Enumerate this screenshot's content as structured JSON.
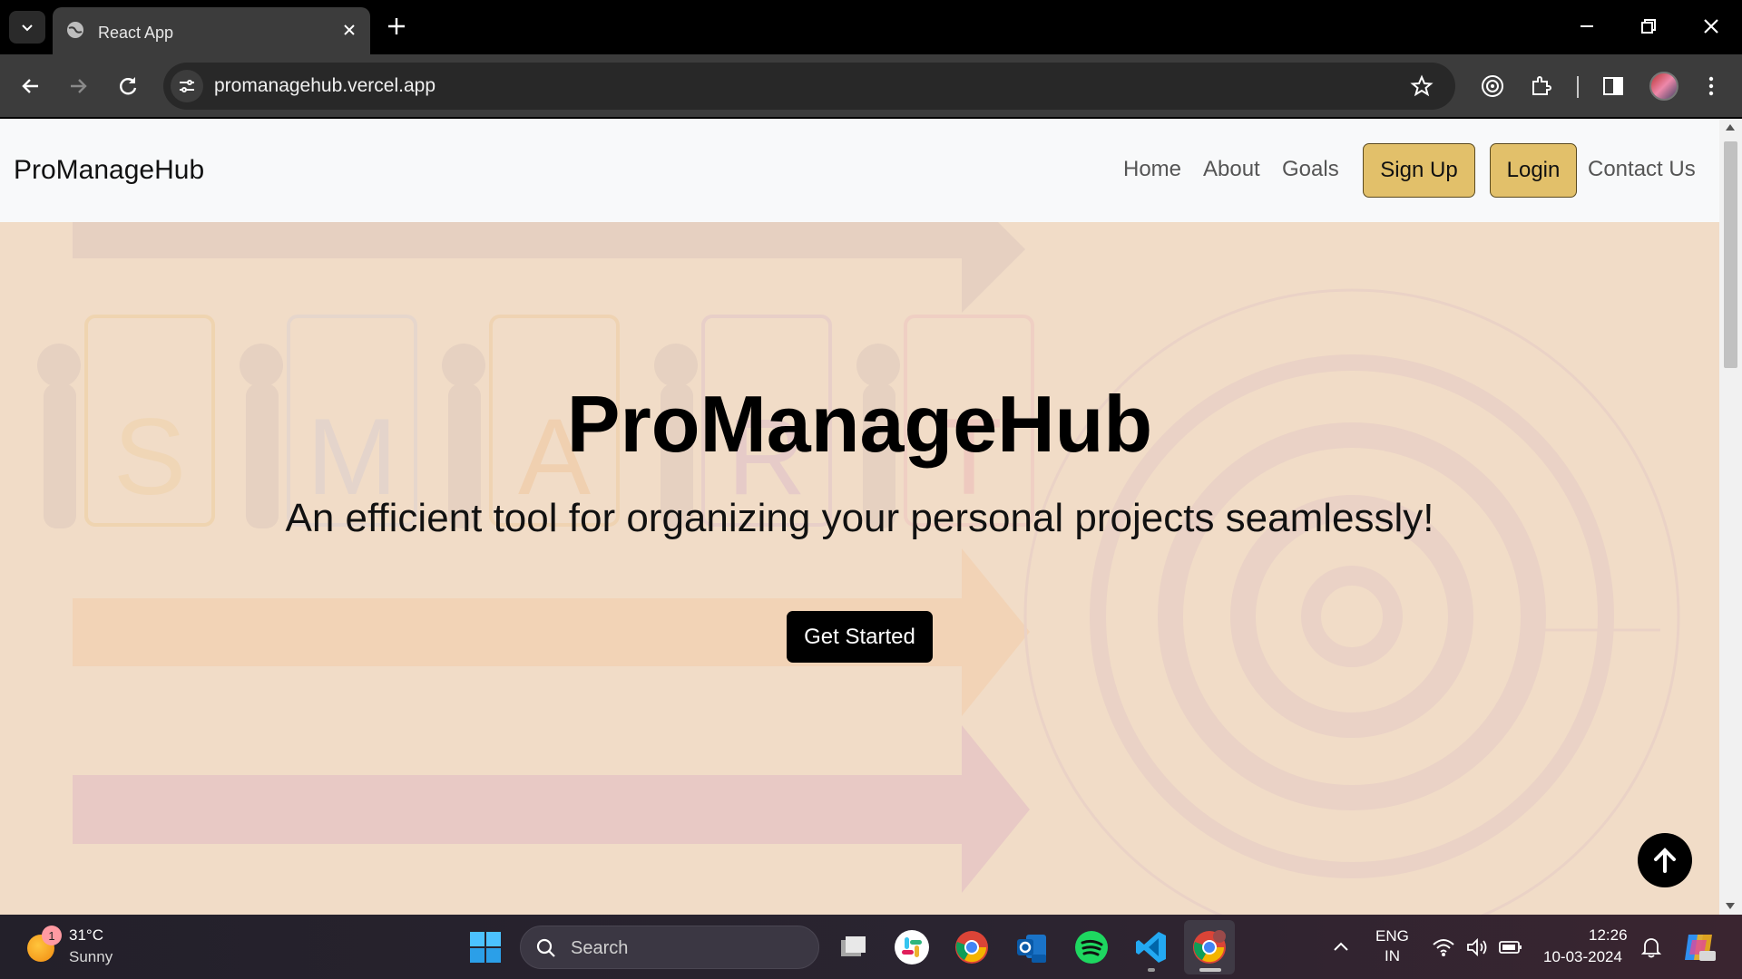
{
  "browser": {
    "tab_title": "React App",
    "url": "promanagehub.vercel.app"
  },
  "navbar": {
    "brand": "ProManageHub",
    "links": [
      "Home",
      "About",
      "Goals"
    ],
    "signup_label": "Sign Up",
    "login_label": "Login",
    "contact_label": "Contact Us"
  },
  "hero": {
    "title": "ProManageHub",
    "subtitle": "An efficient tool for organizing your personal projects seamlessly!",
    "cta_label": "Get Started",
    "background_letters": [
      "S",
      "M",
      "A",
      "R",
      "T"
    ]
  },
  "taskbar": {
    "weather_badge": "1",
    "weather_temp": "31°C",
    "weather_desc": "Sunny",
    "search_placeholder": "Search",
    "lang_line1": "ENG",
    "lang_line2": "IN",
    "time": "12:26",
    "date": "10-03-2024"
  },
  "colors": {
    "hero_bg": "#f1dcc7",
    "accent_button": "#e2c06a",
    "cta_bg": "#000000"
  }
}
